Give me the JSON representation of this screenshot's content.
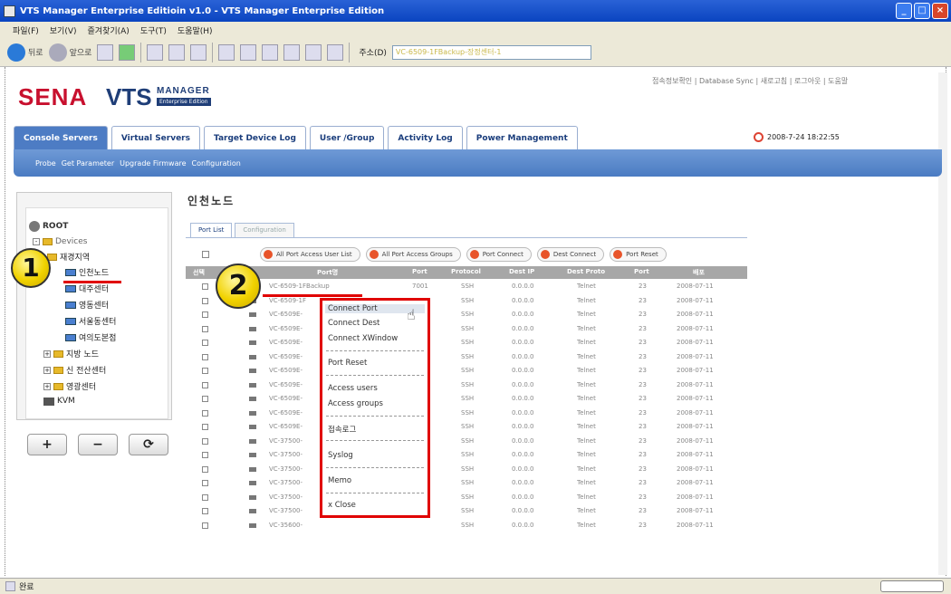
{
  "window": {
    "title": "VTS Manager Enterprise Editioin v1.0 - VTS Manager Enterprise Edition"
  },
  "menubar": [
    "파일(F)",
    "보기(V)",
    "즐겨찾기(A)",
    "도구(T)",
    "도움말(H)"
  ],
  "toolbar": {
    "back": "뒤로",
    "forward": "앞으로",
    "address_label": "주소(D)",
    "address_value": "VC-6509-1FBackup-장정센터-1"
  },
  "header": {
    "logo_sena": "SENA",
    "logo_vts": "VTS",
    "logo_manager": "MANAGER",
    "logo_edition": "Enterprise Edition",
    "top_links": "접속정보확인 | Database Sync | 새로고침 | 로그아웃 | 도움말"
  },
  "tabs": [
    "Console Servers",
    "Virtual Servers",
    "Target Device Log",
    "User /Group",
    "Activity Log",
    "Power Management"
  ],
  "datetime": "2008-7-24  18:22:55",
  "subnav": [
    "Probe",
    "Get Parameter",
    "Upgrade Firmware",
    "Configuration"
  ],
  "tree": {
    "root": "ROOT",
    "devices": "Devices",
    "region": "재경지역",
    "nodes": [
      "인천노드",
      "대주센터",
      "영동센터",
      "서울동센터",
      "여의도본점"
    ],
    "folders": [
      "지방 노드",
      "신 전산센터",
      "영광센터"
    ],
    "kvm": "KVM"
  },
  "tree_buttons": [
    "+",
    "−",
    "⟳"
  ],
  "content": {
    "title": "인천노드",
    "tabs": [
      "Port List",
      "Configuration"
    ],
    "actions": [
      "All Port Access User List",
      "All Port Access Groups",
      "Port Connect",
      "Dest Connect",
      "Port Reset"
    ],
    "columns": [
      "선택",
      "",
      "Port명",
      "Port",
      "Protocol",
      "Dest IP",
      "Dest Proto",
      "Port",
      "배포"
    ],
    "rows": [
      {
        "name": "VC-6509-1FBackup",
        "port": "7001",
        "proto": "SSH",
        "ip": "0.0.0.0",
        "dproto": "Telnet",
        "dport": "23",
        "date": "2008-07-11"
      },
      {
        "name": "VC-6509-1F",
        "port": "",
        "proto": "SSH",
        "ip": "0.0.0.0",
        "dproto": "Telnet",
        "dport": "23",
        "date": "2008-07-11"
      },
      {
        "name": "VC-6509E-",
        "port": "",
        "proto": "SSH",
        "ip": "0.0.0.0",
        "dproto": "Telnet",
        "dport": "23",
        "date": "2008-07-11"
      },
      {
        "name": "VC-6509E-",
        "port": "",
        "proto": "SSH",
        "ip": "0.0.0.0",
        "dproto": "Telnet",
        "dport": "23",
        "date": "2008-07-11"
      },
      {
        "name": "VC-6509E-",
        "port": "",
        "proto": "SSH",
        "ip": "0.0.0.0",
        "dproto": "Telnet",
        "dport": "23",
        "date": "2008-07-11"
      },
      {
        "name": "VC-6509E-",
        "port": "",
        "proto": "SSH",
        "ip": "0.0.0.0",
        "dproto": "Telnet",
        "dport": "23",
        "date": "2008-07-11"
      },
      {
        "name": "VC-6509E-",
        "port": "",
        "proto": "SSH",
        "ip": "0.0.0.0",
        "dproto": "Telnet",
        "dport": "23",
        "date": "2008-07-11"
      },
      {
        "name": "VC-6509E-",
        "port": "",
        "proto": "SSH",
        "ip": "0.0.0.0",
        "dproto": "Telnet",
        "dport": "23",
        "date": "2008-07-11"
      },
      {
        "name": "VC-6509E-",
        "port": "",
        "proto": "SSH",
        "ip": "0.0.0.0",
        "dproto": "Telnet",
        "dport": "23",
        "date": "2008-07-11"
      },
      {
        "name": "VC-6509E-",
        "port": "",
        "proto": "SSH",
        "ip": "0.0.0.0",
        "dproto": "Telnet",
        "dport": "23",
        "date": "2008-07-11"
      },
      {
        "name": "VC-6509E-",
        "port": "",
        "proto": "SSH",
        "ip": "0.0.0.0",
        "dproto": "Telnet",
        "dport": "23",
        "date": "2008-07-11"
      },
      {
        "name": "VC-37500-",
        "port": "",
        "proto": "SSH",
        "ip": "0.0.0.0",
        "dproto": "Telnet",
        "dport": "23",
        "date": "2008-07-11"
      },
      {
        "name": "VC-37500-",
        "port": "",
        "proto": "SSH",
        "ip": "0.0.0.0",
        "dproto": "Telnet",
        "dport": "23",
        "date": "2008-07-11"
      },
      {
        "name": "VC-37500-",
        "port": "",
        "proto": "SSH",
        "ip": "0.0.0.0",
        "dproto": "Telnet",
        "dport": "23",
        "date": "2008-07-11"
      },
      {
        "name": "VC-37500-",
        "port": "",
        "proto": "SSH",
        "ip": "0.0.0.0",
        "dproto": "Telnet",
        "dport": "23",
        "date": "2008-07-11"
      },
      {
        "name": "VC-37500-",
        "port": "",
        "proto": "SSH",
        "ip": "0.0.0.0",
        "dproto": "Telnet",
        "dport": "23",
        "date": "2008-07-11"
      },
      {
        "name": "VC-37500-",
        "port": "",
        "proto": "SSH",
        "ip": "0.0.0.0",
        "dproto": "Telnet",
        "dport": "23",
        "date": "2008-07-11"
      },
      {
        "name": "VC-35600-",
        "port": "",
        "proto": "SSH",
        "ip": "0.0.0.0",
        "dproto": "Telnet",
        "dport": "23",
        "date": "2008-07-11"
      }
    ]
  },
  "context_menu": [
    "Connect Port",
    "Connect Dest",
    "Connect XWindow",
    "Port Reset",
    "Access users",
    "Access groups",
    "접속로그",
    "Syslog",
    "Memo",
    "x Close"
  ],
  "annotations": [
    "1",
    "2"
  ],
  "status": {
    "text": "완료"
  }
}
